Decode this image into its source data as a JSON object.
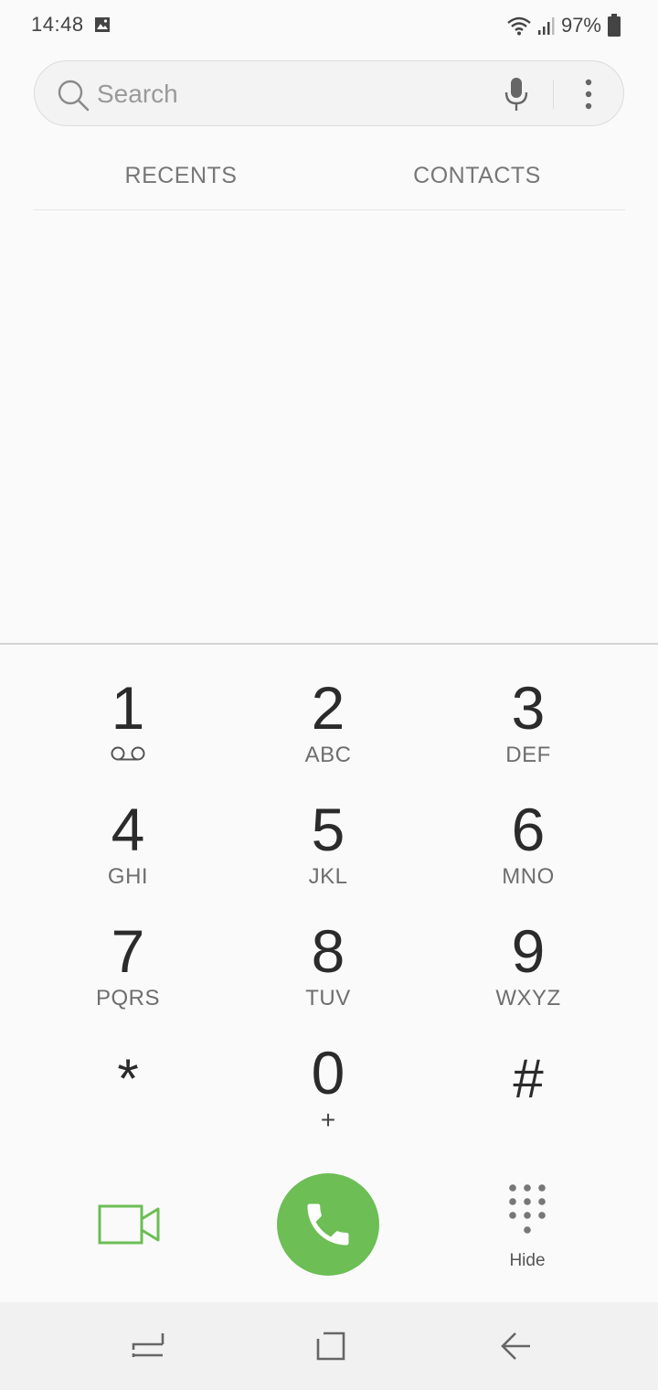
{
  "status_bar": {
    "time": "14:48",
    "battery_percent": "97%",
    "icons": [
      "image-icon",
      "wifi-icon",
      "signal-icon",
      "battery-icon"
    ]
  },
  "search": {
    "placeholder": "Search",
    "value": ""
  },
  "tabs": [
    {
      "label": "RECENTS"
    },
    {
      "label": "CONTACTS"
    }
  ],
  "keypad": {
    "keys": [
      {
        "digit": "1",
        "sub": ""
      },
      {
        "digit": "2",
        "sub": "ABC"
      },
      {
        "digit": "3",
        "sub": "DEF"
      },
      {
        "digit": "4",
        "sub": "GHI"
      },
      {
        "digit": "5",
        "sub": "JKL"
      },
      {
        "digit": "6",
        "sub": "MNO"
      },
      {
        "digit": "7",
        "sub": "PQRS"
      },
      {
        "digit": "8",
        "sub": "TUV"
      },
      {
        "digit": "9",
        "sub": "WXYZ"
      },
      {
        "digit": "*",
        "sub": ""
      },
      {
        "digit": "0",
        "sub": "+"
      },
      {
        "digit": "#",
        "sub": ""
      }
    ]
  },
  "actions": {
    "hide_label": "Hide",
    "call_color": "#6cbe55",
    "video_color": "#6cbe55"
  }
}
